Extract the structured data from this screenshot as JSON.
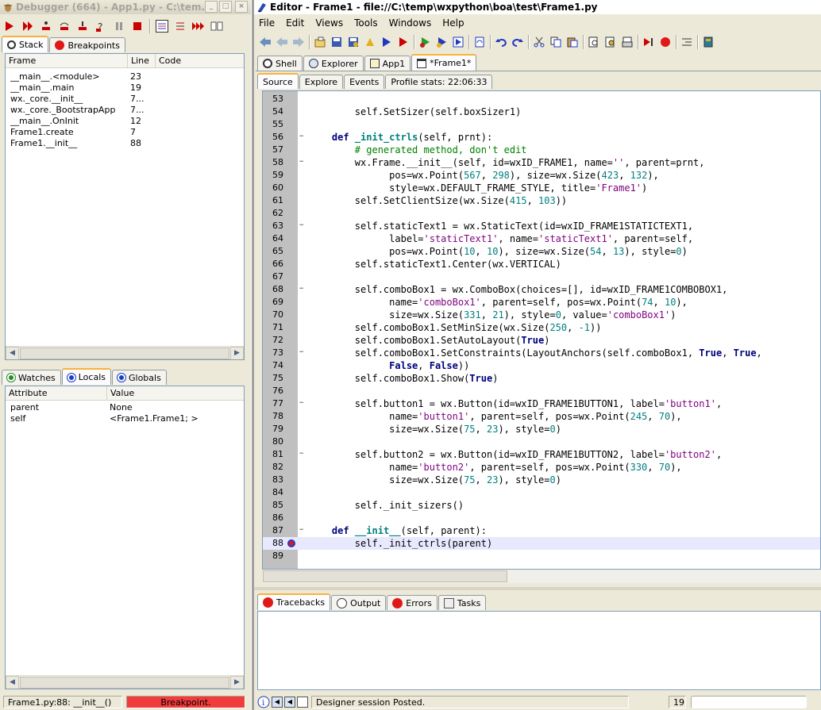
{
  "debugger": {
    "title": "Debugger (664) - App1.py - C:\\tem...",
    "tabs": [
      "Stack",
      "Breakpoints"
    ],
    "stack_columns": [
      "Frame",
      "Line",
      "Code"
    ],
    "stack_rows": [
      {
        "frame": "__main__.<module>",
        "line": "23"
      },
      {
        "frame": "__main__.main",
        "line": "19"
      },
      {
        "frame": "wx._core.__init__",
        "line": "7..."
      },
      {
        "frame": "wx._core._BootstrapApp",
        "line": "7..."
      },
      {
        "frame": "__main__.OnInit",
        "line": "12"
      },
      {
        "frame": "Frame1.create",
        "line": "7"
      },
      {
        "frame": "Frame1.__init__",
        "line": "88"
      }
    ],
    "var_tabs": [
      "Watches",
      "Locals",
      "Globals"
    ],
    "var_columns": [
      "Attribute",
      "Value"
    ],
    "var_rows": [
      {
        "attr": "parent",
        "value": "None"
      },
      {
        "attr": "self",
        "value": "<Frame1.Frame1; >"
      }
    ],
    "status_location": "Frame1.py:88: __init__()",
    "status_state": "Breakpoint."
  },
  "editor": {
    "title": "Editor - Frame1 - file://C:\\temp\\wxpython\\boa\\test\\Frame1.py",
    "menu": [
      "File",
      "Edit",
      "Views",
      "Tools",
      "Windows",
      "Help"
    ],
    "file_tabs": [
      "Shell",
      "Explorer",
      "App1",
      "*Frame1*"
    ],
    "view_tabs": [
      "Source",
      "Explore",
      "Events",
      "Profile stats: 22:06:33"
    ],
    "code_lines": [
      {
        "n": "53",
        "fold": false,
        "segs": [
          {
            "t": "",
            "c": ""
          }
        ]
      },
      {
        "n": "54",
        "fold": false,
        "segs": [
          {
            "t": "        self.SetSizer(self.boxSizer1)",
            "c": ""
          }
        ]
      },
      {
        "n": "55",
        "fold": false,
        "segs": [
          {
            "t": "",
            "c": ""
          }
        ]
      },
      {
        "n": "56",
        "fold": true,
        "segs": [
          {
            "t": "    ",
            "c": ""
          },
          {
            "t": "def",
            "c": "kw"
          },
          {
            "t": " ",
            "c": ""
          },
          {
            "t": "_init_ctrls",
            "c": "fn"
          },
          {
            "t": "(self, prnt):",
            "c": ""
          }
        ]
      },
      {
        "n": "57",
        "fold": false,
        "segs": [
          {
            "t": "        ",
            "c": ""
          },
          {
            "t": "# generated method, don't edit",
            "c": "cm"
          }
        ]
      },
      {
        "n": "58",
        "fold": true,
        "segs": [
          {
            "t": "        wx.Frame.__init__(self, id=wxID_FRAME1, name=",
            "c": ""
          },
          {
            "t": "''",
            "c": "st"
          },
          {
            "t": ", parent=prnt,",
            "c": ""
          }
        ]
      },
      {
        "n": "59",
        "fold": false,
        "segs": [
          {
            "t": "              pos=wx.Point(",
            "c": ""
          },
          {
            "t": "567",
            "c": "nm"
          },
          {
            "t": ", ",
            "c": ""
          },
          {
            "t": "298",
            "c": "nm"
          },
          {
            "t": "), size=wx.Size(",
            "c": ""
          },
          {
            "t": "423",
            "c": "nm"
          },
          {
            "t": ", ",
            "c": ""
          },
          {
            "t": "132",
            "c": "nm"
          },
          {
            "t": "),",
            "c": ""
          }
        ]
      },
      {
        "n": "60",
        "fold": false,
        "segs": [
          {
            "t": "              style=wx.DEFAULT_FRAME_STYLE, title=",
            "c": ""
          },
          {
            "t": "'Frame1'",
            "c": "st"
          },
          {
            "t": ")",
            "c": ""
          }
        ]
      },
      {
        "n": "61",
        "fold": false,
        "segs": [
          {
            "t": "        self.SetClientSize(wx.Size(",
            "c": ""
          },
          {
            "t": "415",
            "c": "nm"
          },
          {
            "t": ", ",
            "c": ""
          },
          {
            "t": "103",
            "c": "nm"
          },
          {
            "t": "))",
            "c": ""
          }
        ]
      },
      {
        "n": "62",
        "fold": false,
        "segs": [
          {
            "t": "",
            "c": ""
          }
        ]
      },
      {
        "n": "63",
        "fold": true,
        "segs": [
          {
            "t": "        self.staticText1 = wx.StaticText(id=wxID_FRAME1STATICTEXT1,",
            "c": ""
          }
        ]
      },
      {
        "n": "64",
        "fold": false,
        "segs": [
          {
            "t": "              label=",
            "c": ""
          },
          {
            "t": "'staticText1'",
            "c": "st"
          },
          {
            "t": ", name=",
            "c": ""
          },
          {
            "t": "'staticText1'",
            "c": "st"
          },
          {
            "t": ", parent=self,",
            "c": ""
          }
        ]
      },
      {
        "n": "65",
        "fold": false,
        "segs": [
          {
            "t": "              pos=wx.Point(",
            "c": ""
          },
          {
            "t": "10",
            "c": "nm"
          },
          {
            "t": ", ",
            "c": ""
          },
          {
            "t": "10",
            "c": "nm"
          },
          {
            "t": "), size=wx.Size(",
            "c": ""
          },
          {
            "t": "54",
            "c": "nm"
          },
          {
            "t": ", ",
            "c": ""
          },
          {
            "t": "13",
            "c": "nm"
          },
          {
            "t": "), style=",
            "c": ""
          },
          {
            "t": "0",
            "c": "nm"
          },
          {
            "t": ")",
            "c": ""
          }
        ]
      },
      {
        "n": "66",
        "fold": false,
        "segs": [
          {
            "t": "        self.staticText1.Center(wx.VERTICAL)",
            "c": ""
          }
        ]
      },
      {
        "n": "67",
        "fold": false,
        "segs": [
          {
            "t": "",
            "c": ""
          }
        ]
      },
      {
        "n": "68",
        "fold": true,
        "segs": [
          {
            "t": "        self.comboBox1 = wx.ComboBox(choices=[], id=wxID_FRAME1COMBOBOX1,",
            "c": ""
          }
        ]
      },
      {
        "n": "69",
        "fold": false,
        "segs": [
          {
            "t": "              name=",
            "c": ""
          },
          {
            "t": "'comboBox1'",
            "c": "st"
          },
          {
            "t": ", parent=self, pos=wx.Point(",
            "c": ""
          },
          {
            "t": "74",
            "c": "nm"
          },
          {
            "t": ", ",
            "c": ""
          },
          {
            "t": "10",
            "c": "nm"
          },
          {
            "t": "),",
            "c": ""
          }
        ]
      },
      {
        "n": "70",
        "fold": false,
        "segs": [
          {
            "t": "              size=wx.Size(",
            "c": ""
          },
          {
            "t": "331",
            "c": "nm"
          },
          {
            "t": ", ",
            "c": ""
          },
          {
            "t": "21",
            "c": "nm"
          },
          {
            "t": "), style=",
            "c": ""
          },
          {
            "t": "0",
            "c": "nm"
          },
          {
            "t": ", value=",
            "c": ""
          },
          {
            "t": "'comboBox1'",
            "c": "st"
          },
          {
            "t": ")",
            "c": ""
          }
        ]
      },
      {
        "n": "71",
        "fold": false,
        "segs": [
          {
            "t": "        self.comboBox1.SetMinSize(wx.Size(",
            "c": ""
          },
          {
            "t": "250",
            "c": "nm"
          },
          {
            "t": ", ",
            "c": ""
          },
          {
            "t": "-1",
            "c": "nm"
          },
          {
            "t": "))",
            "c": ""
          }
        ]
      },
      {
        "n": "72",
        "fold": false,
        "segs": [
          {
            "t": "        self.comboBox1.SetAutoLayout(",
            "c": ""
          },
          {
            "t": "True",
            "c": "kw"
          },
          {
            "t": ")",
            "c": ""
          }
        ]
      },
      {
        "n": "73",
        "fold": true,
        "segs": [
          {
            "t": "        self.comboBox1.SetConstraints(LayoutAnchors(self.comboBox1, ",
            "c": ""
          },
          {
            "t": "True",
            "c": "kw"
          },
          {
            "t": ", ",
            "c": ""
          },
          {
            "t": "True",
            "c": "kw"
          },
          {
            "t": ",",
            "c": ""
          }
        ]
      },
      {
        "n": "74",
        "fold": false,
        "segs": [
          {
            "t": "              ",
            "c": ""
          },
          {
            "t": "False",
            "c": "kw"
          },
          {
            "t": ", ",
            "c": ""
          },
          {
            "t": "False",
            "c": "kw"
          },
          {
            "t": "))",
            "c": ""
          }
        ]
      },
      {
        "n": "75",
        "fold": false,
        "segs": [
          {
            "t": "        self.comboBox1.Show(",
            "c": ""
          },
          {
            "t": "True",
            "c": "kw"
          },
          {
            "t": ")",
            "c": ""
          }
        ]
      },
      {
        "n": "76",
        "fold": false,
        "segs": [
          {
            "t": "",
            "c": ""
          }
        ]
      },
      {
        "n": "77",
        "fold": true,
        "segs": [
          {
            "t": "        self.button1 = wx.Button(id=wxID_FRAME1BUTTON1, label=",
            "c": ""
          },
          {
            "t": "'button1'",
            "c": "st"
          },
          {
            "t": ",",
            "c": ""
          }
        ]
      },
      {
        "n": "78",
        "fold": false,
        "segs": [
          {
            "t": "              name=",
            "c": ""
          },
          {
            "t": "'button1'",
            "c": "st"
          },
          {
            "t": ", parent=self, pos=wx.Point(",
            "c": ""
          },
          {
            "t": "245",
            "c": "nm"
          },
          {
            "t": ", ",
            "c": ""
          },
          {
            "t": "70",
            "c": "nm"
          },
          {
            "t": "),",
            "c": ""
          }
        ]
      },
      {
        "n": "79",
        "fold": false,
        "segs": [
          {
            "t": "              size=wx.Size(",
            "c": ""
          },
          {
            "t": "75",
            "c": "nm"
          },
          {
            "t": ", ",
            "c": ""
          },
          {
            "t": "23",
            "c": "nm"
          },
          {
            "t": "), style=",
            "c": ""
          },
          {
            "t": "0",
            "c": "nm"
          },
          {
            "t": ")",
            "c": ""
          }
        ]
      },
      {
        "n": "80",
        "fold": false,
        "segs": [
          {
            "t": "",
            "c": ""
          }
        ]
      },
      {
        "n": "81",
        "fold": true,
        "segs": [
          {
            "t": "        self.button2 = wx.Button(id=wxID_FRAME1BUTTON2, label=",
            "c": ""
          },
          {
            "t": "'button2'",
            "c": "st"
          },
          {
            "t": ",",
            "c": ""
          }
        ]
      },
      {
        "n": "82",
        "fold": false,
        "segs": [
          {
            "t": "              name=",
            "c": ""
          },
          {
            "t": "'button2'",
            "c": "st"
          },
          {
            "t": ", parent=self, pos=wx.Point(",
            "c": ""
          },
          {
            "t": "330",
            "c": "nm"
          },
          {
            "t": ", ",
            "c": ""
          },
          {
            "t": "70",
            "c": "nm"
          },
          {
            "t": "),",
            "c": ""
          }
        ]
      },
      {
        "n": "83",
        "fold": false,
        "segs": [
          {
            "t": "              size=wx.Size(",
            "c": ""
          },
          {
            "t": "75",
            "c": "nm"
          },
          {
            "t": ", ",
            "c": ""
          },
          {
            "t": "23",
            "c": "nm"
          },
          {
            "t": "), style=",
            "c": ""
          },
          {
            "t": "0",
            "c": "nm"
          },
          {
            "t": ")",
            "c": ""
          }
        ]
      },
      {
        "n": "84",
        "fold": false,
        "segs": [
          {
            "t": "",
            "c": ""
          }
        ]
      },
      {
        "n": "85",
        "fold": false,
        "segs": [
          {
            "t": "        self._init_sizers()",
            "c": ""
          }
        ]
      },
      {
        "n": "86",
        "fold": false,
        "segs": [
          {
            "t": "",
            "c": ""
          }
        ]
      },
      {
        "n": "87",
        "fold": true,
        "segs": [
          {
            "t": "    ",
            "c": ""
          },
          {
            "t": "def",
            "c": "kw"
          },
          {
            "t": " ",
            "c": ""
          },
          {
            "t": "__init__",
            "c": "fn"
          },
          {
            "t": "(self, parent):",
            "c": ""
          }
        ]
      },
      {
        "n": "88",
        "fold": false,
        "bp": true,
        "hl": true,
        "segs": [
          {
            "t": "        self._init_ctrls(parent)",
            "c": ""
          }
        ]
      },
      {
        "n": "89",
        "fold": false,
        "segs": [
          {
            "t": "",
            "c": ""
          }
        ]
      }
    ],
    "bottom_tabs": [
      "Tracebacks",
      "Output",
      "Errors",
      "Tasks"
    ],
    "status_message": "Designer session Posted.",
    "status_line": "19"
  },
  "colors": {
    "breakpoint_bar": "#f03c3c",
    "accent_tab": "#f8b33c",
    "gutter": "#c0c0c0",
    "current_line": "#e8e8ff"
  }
}
